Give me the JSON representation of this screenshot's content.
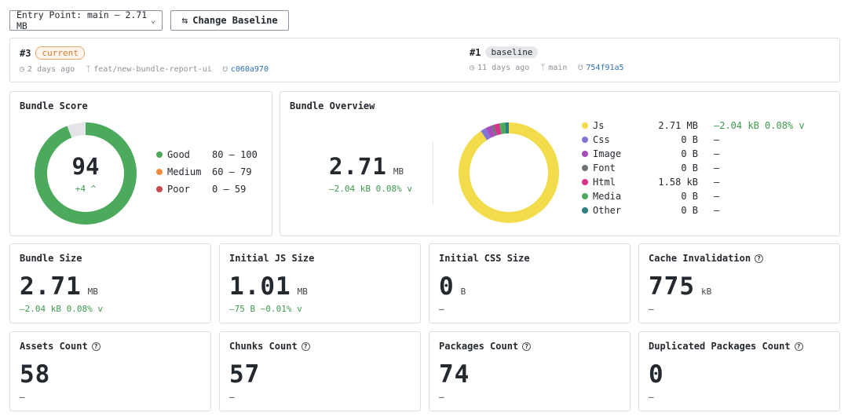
{
  "toolbar": {
    "entry_point": "Entry Point: main – 2.71 MB",
    "change_baseline": "Change Baseline"
  },
  "current": {
    "number": "#3",
    "badge": "current",
    "age": "2 days ago",
    "branch": "feat/new-bundle-report-ui",
    "commit": "c060a970"
  },
  "baseline": {
    "number": "#1",
    "badge": "baseline",
    "age": "11 days ago",
    "branch": "main",
    "commit": "754f91a5"
  },
  "score": {
    "title": "Bundle Score",
    "value": "94",
    "change": "+4 ^",
    "fraction": 0.94,
    "legend": [
      {
        "label": "Good",
        "range": "80 – 100",
        "color": "#4caa5c"
      },
      {
        "label": "Medium",
        "range": "60 – 79",
        "color": "#f08c3a"
      },
      {
        "label": "Poor",
        "range": "0 – 59",
        "color": "#c94a4a"
      }
    ]
  },
  "overview": {
    "title": "Bundle Overview",
    "total_value": "2.71",
    "total_unit": "MB",
    "total_change": "–2.04 kB 0.08% v",
    "rows": [
      {
        "name": "Js",
        "value": "2.71 MB",
        "change": "–2.04 kB 0.08% v",
        "color": "#f2dc4b"
      },
      {
        "name": "Css",
        "value": "0 B",
        "change": "–",
        "color": "#8474d6"
      },
      {
        "name": "Image",
        "value": "0 B",
        "change": "–",
        "color": "#a84cb8"
      },
      {
        "name": "Font",
        "value": "0 B",
        "change": "–",
        "color": "#6e7378"
      },
      {
        "name": "Html",
        "value": "1.58 kB",
        "change": "–",
        "color": "#d8338c"
      },
      {
        "name": "Media",
        "value": "0 B",
        "change": "–",
        "color": "#4caa5c"
      },
      {
        "name": "Other",
        "value": "0 B",
        "change": "–",
        "color": "#2e7d80"
      }
    ]
  },
  "stats": [
    {
      "title": "Bundle Size",
      "value": "2.71",
      "unit": "MB",
      "change": "–2.04 kB 0.08% v",
      "help": false,
      "positive": true
    },
    {
      "title": "Initial JS Size",
      "value": "1.01",
      "unit": "MB",
      "change": "–75 B ~0.01% v",
      "help": false,
      "positive": true
    },
    {
      "title": "Initial CSS Size",
      "value": "0",
      "unit": "B",
      "change": "–",
      "help": false,
      "positive": false
    },
    {
      "title": "Cache Invalidation",
      "value": "775",
      "unit": "kB",
      "change": "–",
      "help": true,
      "positive": false
    },
    {
      "title": "Assets Count",
      "value": "58",
      "unit": "",
      "change": "–",
      "help": true,
      "positive": false
    },
    {
      "title": "Chunks Count",
      "value": "57",
      "unit": "",
      "change": "–",
      "help": true,
      "positive": false
    },
    {
      "title": "Packages Count",
      "value": "74",
      "unit": "",
      "change": "–",
      "help": true,
      "positive": false
    },
    {
      "title": "Duplicated Packages Count",
      "value": "0",
      "unit": "",
      "change": "–",
      "help": true,
      "positive": false
    }
  ]
}
